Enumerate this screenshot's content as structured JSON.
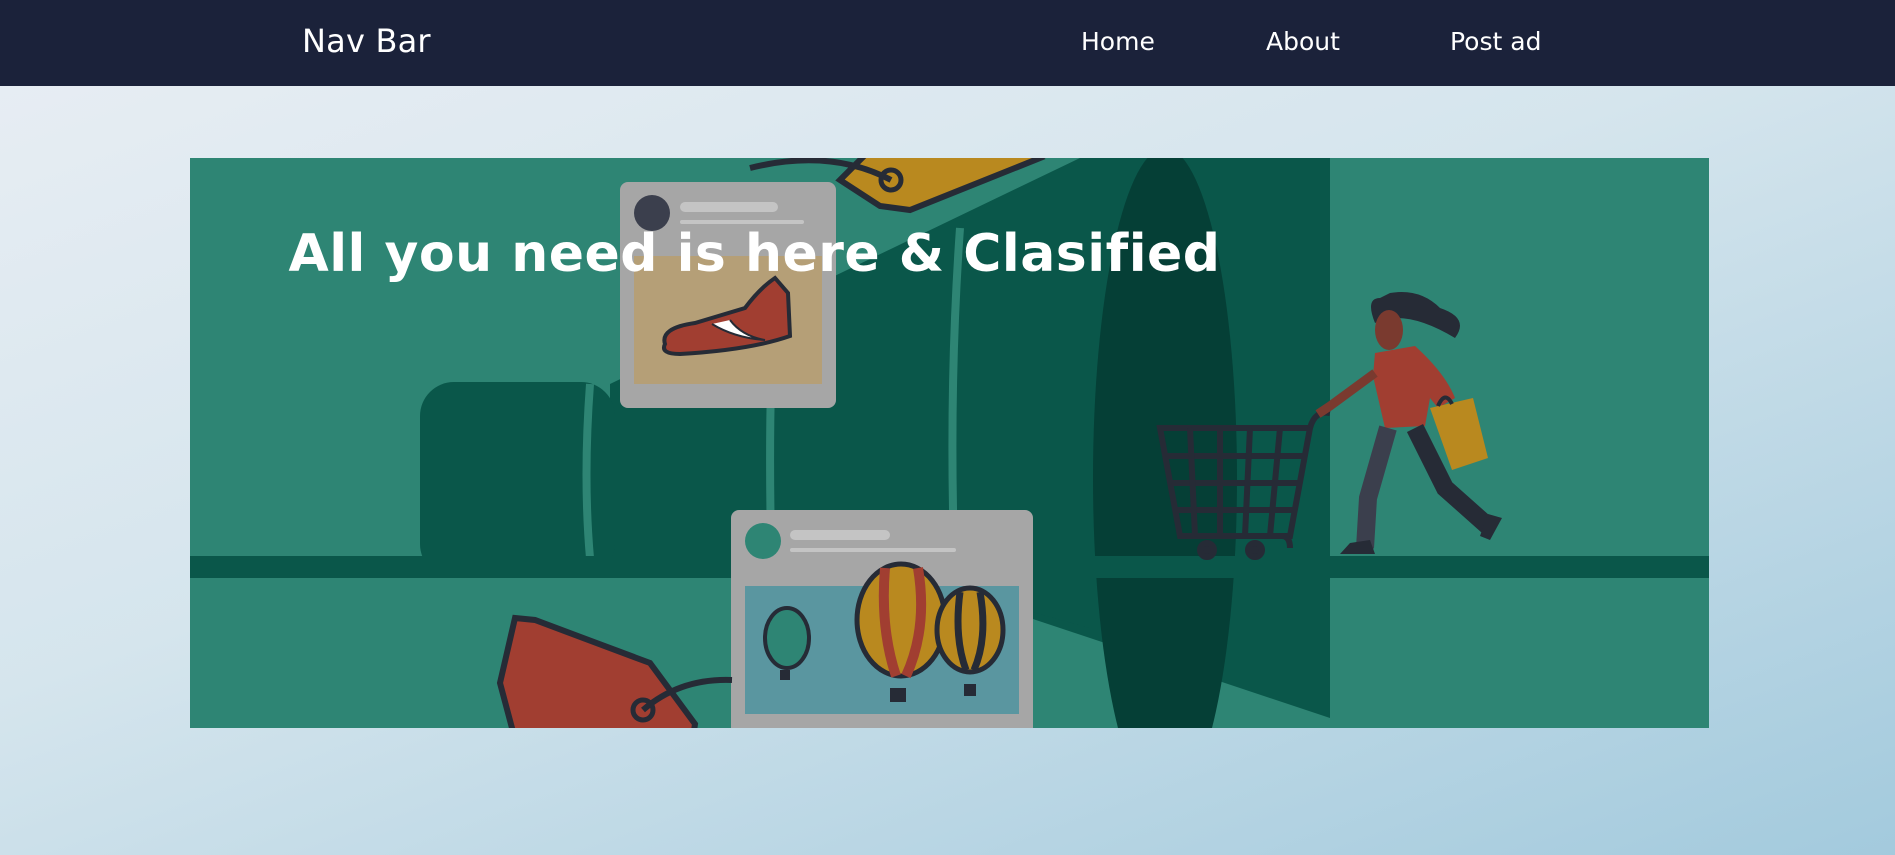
{
  "navbar": {
    "brand": "Nav Bar",
    "links": [
      {
        "label": "Home"
      },
      {
        "label": "About"
      },
      {
        "label": "Post ad"
      }
    ]
  },
  "hero": {
    "title": "All you need is here & Clasified"
  },
  "colors": {
    "navbar_bg": "#1b223a",
    "hero_bg": "#2e8574",
    "hero_dark": "#0a574a",
    "accent_red": "#a13e31",
    "accent_gold": "#b9891f"
  }
}
